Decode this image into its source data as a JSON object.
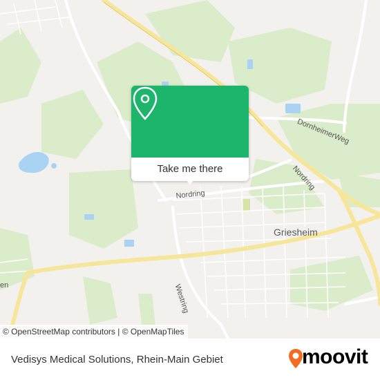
{
  "map": {
    "labels": {
      "nordring_west": "Nordring",
      "nordring_east": "Nordring",
      "dornheimer_weg": "DornheimerWeg",
      "westring": "Westring",
      "griesheim": "Griesheim",
      "edge": "en"
    },
    "colors": {
      "background": "#f2f1ee",
      "green_area": "#dbeccb",
      "water": "#aad3f3",
      "major_road": "#f7e59a",
      "minor_road": "#ffffff",
      "accent": "#1db46b"
    }
  },
  "popup": {
    "icon": "location-pin-icon",
    "cta_label": "Take me there"
  },
  "attribution": {
    "text": "© OpenStreetMap contributors | © OpenMapTiles"
  },
  "footer": {
    "title": "Vedisys Medical Solutions, Rhein-Main Gebiet",
    "brand": "moovit",
    "brand_color": "#f36c21"
  }
}
